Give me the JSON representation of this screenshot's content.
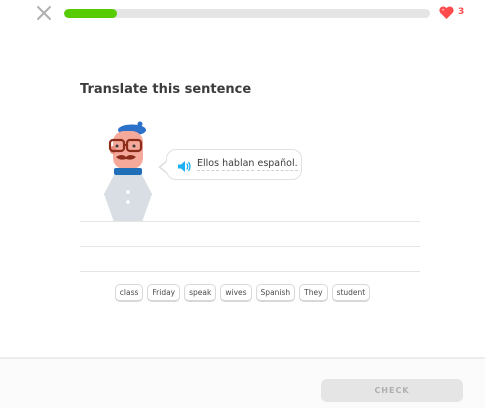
{
  "progress": {
    "fraction": 0.145
  },
  "hearts": {
    "count": "3",
    "icon": "heart-icon",
    "color": "#ff4b4b"
  },
  "header": {
    "close_icon": "close-icon"
  },
  "challenge": {
    "title": "Translate this sentence",
    "sentence_words": [
      "Ellos",
      "hablan",
      "español."
    ],
    "speaker_icon": "speaker-icon"
  },
  "word_bank": [
    "class",
    "Friday",
    "speak",
    "wives",
    "Spanish",
    "They",
    "student"
  ],
  "footer": {
    "check_label": "CHECK"
  },
  "colors": {
    "accent_green": "#58cc02",
    "speaker_blue": "#1cb0f6",
    "heart_red": "#ff4b4b"
  }
}
